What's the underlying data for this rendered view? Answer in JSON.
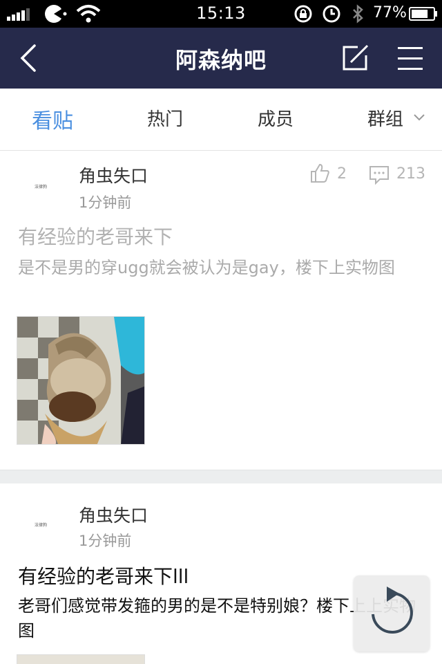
{
  "status_bar": {
    "time": "15:13",
    "battery_percent": "77%",
    "battery_level": 0.77,
    "icons": [
      "signal-icon",
      "carrier-icon",
      "wifi-icon",
      "rotation-lock-icon",
      "alarm-icon",
      "bluetooth-icon",
      "battery-icon"
    ]
  },
  "nav": {
    "title": "阿森纳吧",
    "back_icon": "chevron-left-icon",
    "edit_icon": "compose-icon",
    "menu_icon": "menu-icon",
    "bg_color": "#262a4b"
  },
  "tabs": [
    {
      "label": "看贴",
      "active": true
    },
    {
      "label": "热门",
      "active": false
    },
    {
      "label": "成员",
      "active": false
    },
    {
      "label": "群组",
      "active": false
    }
  ],
  "accent_color": "#4a8fe0",
  "posts": [
    {
      "author": "角虫失口",
      "avatar_text": "法律狗",
      "time": "1分钟前",
      "likes": "2",
      "comments": "213",
      "title": "有经验的老哥来下",
      "body": "是不是男的穿ugg就会被认为是gay，楼下上实物图",
      "image": "ice-cream-cone-photo"
    },
    {
      "author": "角虫失口",
      "avatar_text": "法律狗",
      "time": "1分钟前",
      "title": "有经验的老哥来下lll",
      "body": "老哥们感觉带发箍的男的是不是特别娘？楼下上上实物图",
      "image": "photo"
    }
  ],
  "refresh_button": {
    "icon": "refresh-icon"
  }
}
